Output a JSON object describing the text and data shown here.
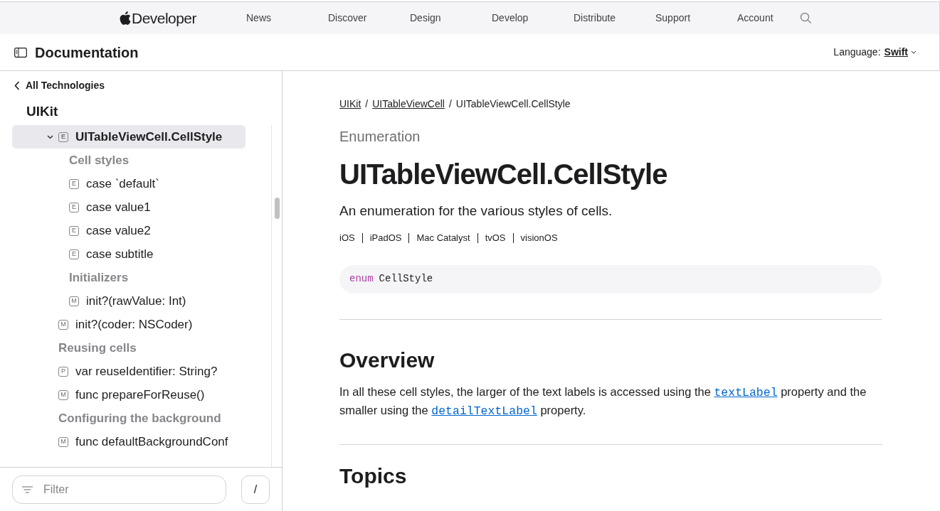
{
  "global_nav": {
    "brand": "Developer",
    "items": [
      "News",
      "Discover",
      "Design",
      "Develop",
      "Distribute",
      "Support",
      "Account"
    ]
  },
  "doc_header": {
    "title": "Documentation",
    "language_label": "Language:",
    "language": "Swift"
  },
  "sidebar": {
    "back_link": "All Technologies",
    "framework": "UIKit",
    "tree": [
      {
        "kind": "symbol",
        "badge": "E",
        "label": "UITableViewCell.CellStyle",
        "selected": true,
        "expanded": true,
        "children": [
          {
            "kind": "heading",
            "label": "Cell styles"
          },
          {
            "kind": "symbol",
            "badge": "E",
            "label": "case `default`",
            "selected": false
          },
          {
            "kind": "symbol",
            "badge": "E",
            "label": "case value1",
            "selected": false
          },
          {
            "kind": "symbol",
            "badge": "E",
            "label": "case value2",
            "selected": false
          },
          {
            "kind": "symbol",
            "badge": "E",
            "label": "case subtitle",
            "selected": false
          },
          {
            "kind": "heading",
            "label": "Initializers"
          },
          {
            "kind": "symbol",
            "badge": "M",
            "label": "init?(rawValue: Int)",
            "selected": false
          }
        ]
      },
      {
        "kind": "symbol",
        "badge": "M",
        "label": "init?(coder: NSCoder)",
        "selected": false
      },
      {
        "kind": "heading",
        "label": "Reusing cells"
      },
      {
        "kind": "symbol",
        "badge": "P",
        "label": "var reuseIdentifier: String?",
        "selected": false
      },
      {
        "kind": "symbol",
        "badge": "M",
        "label": "func prepareForReuse()",
        "selected": false
      },
      {
        "kind": "heading",
        "label": "Configuring the background"
      },
      {
        "kind": "symbol",
        "badge": "M",
        "label": "func defaultBackgroundConf",
        "selected": false
      }
    ],
    "filter": {
      "placeholder": "Filter"
    },
    "shortcut": "/"
  },
  "content": {
    "breadcrumb_separators": [
      "/",
      "/"
    ],
    "breadcrumbs": [
      {
        "label": "UIKit",
        "link": true
      },
      {
        "label": "UITableViewCell",
        "link": true
      },
      {
        "label": "UITableViewCell.CellStyle",
        "link": false
      }
    ],
    "role": "Enumeration",
    "title": "UITableViewCell.CellStyle",
    "abstract": "An enumeration for the various styles of cells.",
    "platforms": [
      "iOS",
      "iPadOS",
      "Mac Catalyst",
      "tvOS",
      "visionOS"
    ],
    "declaration": [
      {
        "kind": "keyword",
        "text": "enum"
      },
      {
        "kind": "plain",
        "text": "CellStyle"
      }
    ],
    "overview": {
      "heading": "Overview",
      "paragraph": [
        {
          "kind": "text",
          "text": "In all these cell styles, the larger of the text labels is accessed using the "
        },
        {
          "kind": "code_link",
          "text": "textLabel"
        },
        {
          "kind": "text",
          "text": " property and the smaller using the "
        },
        {
          "kind": "code_link",
          "text": "detailTextLabel"
        },
        {
          "kind": "text",
          "text": " property."
        }
      ]
    },
    "topics_heading": "Topics"
  }
}
